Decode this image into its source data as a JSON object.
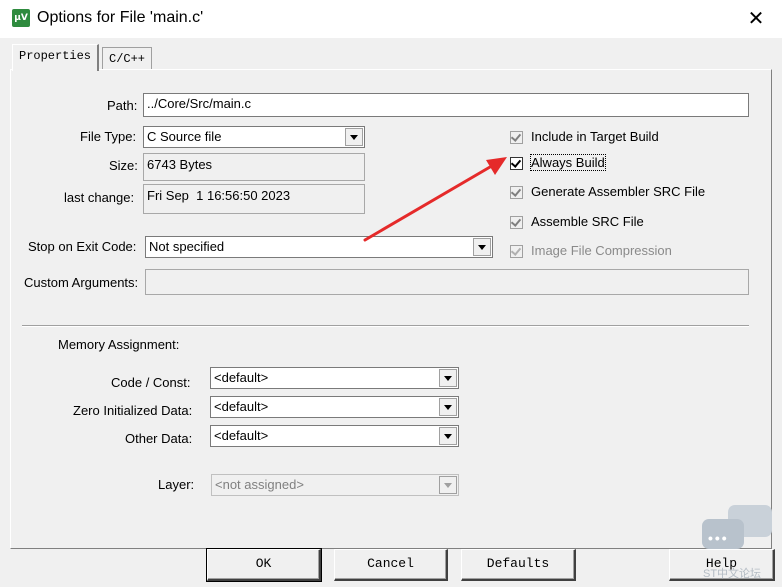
{
  "window": {
    "title": "Options for File 'main.c'",
    "app_icon_text": "µV",
    "close_glyph": "✕"
  },
  "tabs": [
    {
      "label": "Properties"
    },
    {
      "label": "C/C++"
    }
  ],
  "properties": {
    "path_label": "Path:",
    "path_value": "../Core/Src/main.c",
    "file_type_label": "File Type:",
    "file_type_value": "C Source file",
    "size_label": "Size:",
    "size_value": "6743 Bytes",
    "last_change_label": "last change:",
    "last_change_value": "Fri Sep  1 16:56:50 2023",
    "stop_on_exit_label": "Stop on Exit Code:",
    "stop_on_exit_value": "Not specified",
    "custom_args_label": "Custom Arguments:",
    "custom_args_value": ""
  },
  "options": [
    {
      "label": "Include in Target Build",
      "checked": true,
      "enabled": false
    },
    {
      "label": "Always Build",
      "checked": true,
      "enabled": true
    },
    {
      "label": "Generate Assembler SRC File",
      "checked": true,
      "enabled": false
    },
    {
      "label": "Assemble SRC File",
      "checked": true,
      "enabled": false
    },
    {
      "label": "Image File Compression",
      "checked": true,
      "enabled": false
    }
  ],
  "memory": {
    "section_label": "Memory Assignment:",
    "code_const_label": "Code / Const:",
    "code_const_value": "<default>",
    "zero_init_label": "Zero Initialized Data:",
    "zero_init_value": "<default>",
    "other_data_label": "Other Data:",
    "other_data_value": "<default>",
    "layer_label": "Layer:",
    "layer_value": "<not assigned>"
  },
  "buttons": {
    "ok": "OK",
    "cancel": "Cancel",
    "defaults": "Defaults",
    "help": "Help"
  },
  "annotation": {
    "arrow_color": "#e52a2a"
  },
  "watermark": {
    "text": "ST中文论坛",
    "dots": "•••"
  }
}
